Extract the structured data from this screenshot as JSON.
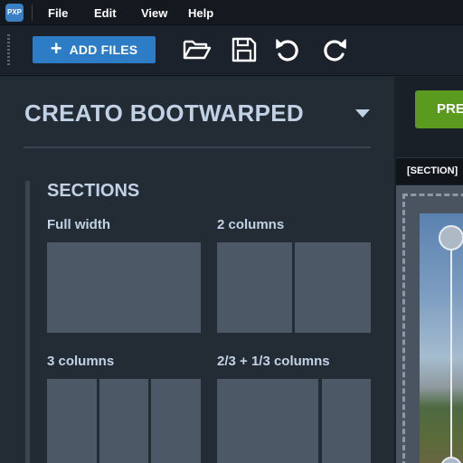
{
  "app": {
    "logo_text": "PXP"
  },
  "menu": {
    "items": [
      "File",
      "Edit",
      "View",
      "Help"
    ]
  },
  "toolbar": {
    "add_files_label": "ADD FILES",
    "add_icon": "plus-icon",
    "icons": [
      "folder-open-icon",
      "save-icon",
      "undo-icon",
      "redo-icon"
    ]
  },
  "panel": {
    "title": "CREATO BOOTWARPED",
    "caret_icon": "chevron-down-icon",
    "sections_heading": "SECTIONS",
    "layouts": [
      {
        "label": "Full width",
        "columns": [
          1
        ]
      },
      {
        "label": "2 columns",
        "columns": [
          1,
          1
        ]
      },
      {
        "label": "3 columns",
        "columns": [
          1,
          1,
          1
        ]
      },
      {
        "label": "2/3 + 1/3 columns",
        "columns": [
          2,
          1
        ]
      }
    ]
  },
  "preview": {
    "button_label": "PRE",
    "tab_label": "[SECTION]"
  },
  "colors": {
    "accent_blue": "#2d7cc6",
    "accent_green": "#5a9a1e",
    "panel_bg": "#232b35",
    "heading_text": "#c2d2e6",
    "block_fill": "#4d5866"
  }
}
